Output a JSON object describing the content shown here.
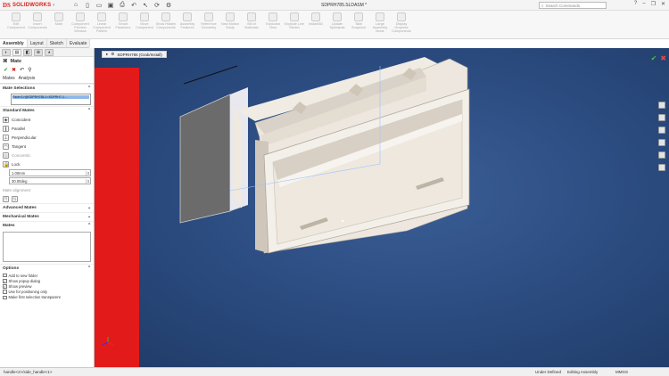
{
  "app": {
    "brand": "SOLIDWORKS",
    "logo_mark": "DS",
    "document_title": "SDPRH785.SLDASM *"
  },
  "search": {
    "placeholder": "Search Commands"
  },
  "ribbon": {
    "buttons": [
      "Edit Component",
      "Insert Components",
      "Mate",
      "Component Preview Window",
      "Linear Component Pattern",
      "Smart Fasteners",
      "Move Component",
      "Show Hidden Components",
      "Assembly Features",
      "Reference Geometry",
      "New Motion Study",
      "Bill of Materials",
      "Exploded View",
      "Explode Line Sketch",
      "Instant3D",
      "Update Speedpak",
      "Take Snapshot",
      "Large Assembly Mode",
      "Display Graphics Components"
    ]
  },
  "command_tabs": [
    "Assembly",
    "Layout",
    "Sketch",
    "Evaluate"
  ],
  "property_manager": {
    "title": "Mate",
    "subtabs": [
      "Mates",
      "Analysis"
    ],
    "sections": {
      "mate_selections": "Mate Selections",
      "standard_mates": "Standard Mates",
      "advanced_mates": "Advanced Mates",
      "mechanical_mates": "Mechanical Mates",
      "mates": "Mates",
      "options": "Options"
    },
    "selection_text": "Face<1>@SDPRH785-1<SDPRH7-1...",
    "standard_mates": [
      {
        "label": "Coincident",
        "icon": "coincident-icon",
        "enabled": true
      },
      {
        "label": "Parallel",
        "icon": "parallel-icon",
        "enabled": true
      },
      {
        "label": "Perpendicular",
        "icon": "perpendicular-icon",
        "enabled": true
      },
      {
        "label": "Tangent",
        "icon": "tangent-icon",
        "enabled": true
      },
      {
        "label": "Concentric",
        "icon": "concentric-icon",
        "enabled": false
      },
      {
        "label": "Lock",
        "icon": "lock-icon",
        "enabled": true
      }
    ],
    "distance_value": "1.00mm",
    "angle_value": "30.00deg",
    "mate_alignment": "Mate alignment:",
    "options": [
      {
        "label": "Add to new folder",
        "checked": false
      },
      {
        "label": "Show popup dialog",
        "checked": true
      },
      {
        "label": "Show preview",
        "checked": true
      },
      {
        "label": "Use for positioning only",
        "checked": false
      },
      {
        "label": "Make first selection transparent",
        "checked": false
      }
    ]
  },
  "viewport": {
    "tree_item": "SDPRH785 (Grab/Install)"
  },
  "status": {
    "selection": "handle<2>/side_handle<1>",
    "state": "Under Defined",
    "mode": "Editing Assembly",
    "units": "MMGS"
  }
}
